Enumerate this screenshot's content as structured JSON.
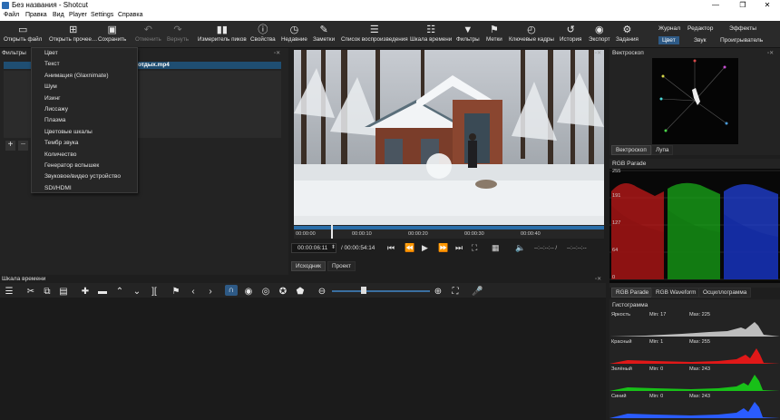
{
  "window": {
    "title": "Без названия - Shotcut",
    "controls": [
      "—",
      "❐",
      "✕"
    ]
  },
  "menubar": [
    "Файл",
    "Правка",
    "Вид",
    "Player",
    "Settings",
    "Справка"
  ],
  "toolbar": {
    "open": "Открыть файл",
    "open_other": "Открыть прочее…",
    "save": "Сохранить",
    "undo": "Отменить",
    "redo": "Вернуть",
    "peak_meter": "Измеритель пиков",
    "properties": "Свойства",
    "recent": "Недавние",
    "notes": "Заметки",
    "playlist": "Список воспроизведения",
    "timeline": "Шкала времени",
    "filters": "Фильтры",
    "markers": "Метки",
    "keyframes": "Ключевые кадры",
    "history": "История",
    "export": "Экспорт",
    "jobs": "Задания"
  },
  "layouts": {
    "row1": [
      "Журнал",
      "Редактор",
      "Эффекты"
    ],
    "row2": [
      "Цвет",
      "Звук",
      "Проигрыватель"
    ],
    "selected": "Цвет"
  },
  "filters_panel": {
    "title": "Фильтры",
    "clip": "отдых.mp4",
    "add": "+",
    "remove": "−"
  },
  "context_menu": [
    "Цвет",
    "Текст",
    "Анимация (Glaxnimate)",
    "Шум",
    "Изинг",
    "Лиссажу",
    "Плазма",
    "Цветовые шкалы",
    "Тембр звука",
    "Количество",
    "Генератор вспышек",
    "Звуковое/видео устройство",
    "SDI/HDMI"
  ],
  "player": {
    "ruler": [
      "00:00:00",
      "00:00:10",
      "00:00:20",
      "00:00:30",
      "00:00:40"
    ],
    "current": "00:00:06:11",
    "duration": "/ 00:00:54:14",
    "in": "--:--:--:-- /",
    "out": "--:--:--:--",
    "tabs": [
      "Исходник",
      "Проект"
    ],
    "selected_tab": "Исходник",
    "progress": 0.12
  },
  "vectorscope": {
    "title": "Вектроскоп",
    "tabs": [
      "Вектроскоп",
      "Лупа"
    ],
    "selected": "Вектроскоп"
  },
  "rgb_parade": {
    "title": "RGB Parade",
    "scale": [
      "255",
      "191",
      "127",
      "64",
      "0"
    ],
    "tabs": [
      "RGB Parade",
      "RGB Waveform",
      "Осциллограмма"
    ],
    "selected": "RGB Parade"
  },
  "histogram": {
    "title": "Гистограмма",
    "rows": [
      {
        "label": "Яркость",
        "min": "Min: 17",
        "max": "Max: 225",
        "color": "#bdbdbd"
      },
      {
        "label": "Красный",
        "min": "Min: 1",
        "max": "Max: 255",
        "color": "#e01818"
      },
      {
        "label": "Зелёный",
        "min": "Min: 0",
        "max": "Max: 243",
        "color": "#18c018"
      },
      {
        "label": "Синий",
        "min": "Min: 0",
        "max": "Max: 243",
        "color": "#2a5cff"
      }
    ]
  },
  "timeline": {
    "title": "Шкала времени"
  },
  "colors": {
    "accent": "#2e5a86",
    "bg": "#1e1e1e"
  }
}
